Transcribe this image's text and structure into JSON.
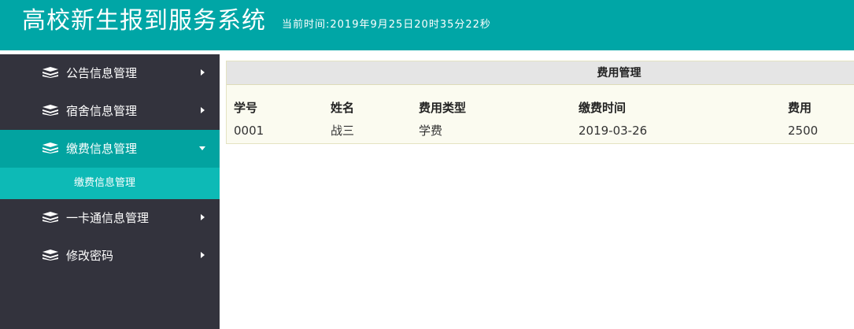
{
  "header": {
    "title": "高校新生报到服务系统",
    "time": "当前时间:2019年9月25日20时35分22秒"
  },
  "colors": {
    "header_bg": "#00a6a6",
    "sidebar_bg": "#33333d",
    "active_bg": "#02a3a0",
    "sub_bg": "#0dbab6",
    "panel_title_bg": "#e5e5e5",
    "panel_bg": "#fbfbf0"
  },
  "sidebar": {
    "items": [
      {
        "label": "公告信息管理",
        "icon": "stack-icon",
        "arrow": "caret-right-icon"
      },
      {
        "label": "宿舍信息管理",
        "icon": "stack-icon",
        "arrow": "caret-right-icon"
      },
      {
        "label": "缴费信息管理",
        "icon": "stack-icon",
        "arrow": "caret-down-icon",
        "expanded": true
      },
      {
        "label": "一卡通信息管理",
        "icon": "stack-icon",
        "arrow": "caret-right-icon"
      },
      {
        "label": "修改密码",
        "icon": "stack-icon",
        "arrow": "caret-right-icon"
      }
    ],
    "sub_item": {
      "label": "缴费信息管理"
    }
  },
  "main": {
    "panel_title": "费用管理",
    "table": {
      "headers": [
        "学号",
        "姓名",
        "费用类型",
        "缴费时间",
        "费用"
      ],
      "rows": [
        [
          "0001",
          "战三",
          "学费",
          "2019-03-26",
          "2500"
        ]
      ]
    }
  }
}
